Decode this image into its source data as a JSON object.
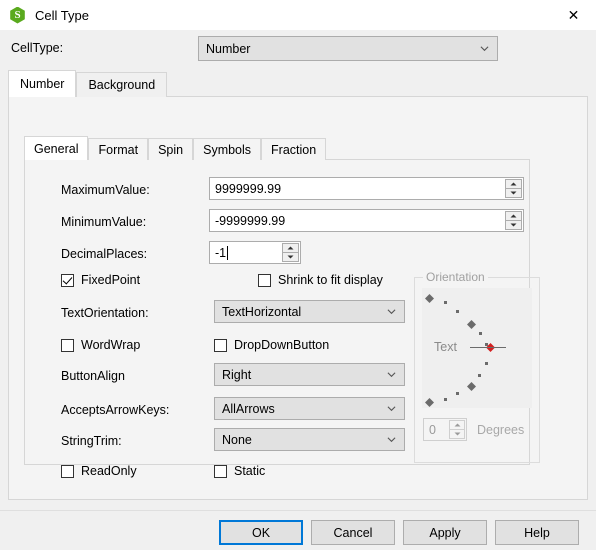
{
  "window": {
    "title": "Cell Type",
    "icon": "spreadsheet-logo-icon",
    "close_label": "✕"
  },
  "celltype": {
    "label": "CellType:",
    "value": "Number"
  },
  "outer_tabs": [
    {
      "label": "Number",
      "active": true
    },
    {
      "label": "Background",
      "active": false
    }
  ],
  "inner_tabs": [
    {
      "label": "General",
      "active": true
    },
    {
      "label": "Format",
      "active": false
    },
    {
      "label": "Spin",
      "active": false
    },
    {
      "label": "Symbols",
      "active": false
    },
    {
      "label": "Fraction",
      "active": false
    }
  ],
  "general": {
    "maximum_value": {
      "label": "MaximumValue:",
      "value": "9999999.99"
    },
    "minimum_value": {
      "label": "MinimumValue:",
      "value": "-9999999.99"
    },
    "decimal_places": {
      "label": "DecimalPlaces:",
      "value": "-1"
    },
    "fixed_point": {
      "label": "FixedPoint",
      "checked": true
    },
    "shrink_to_fit": {
      "label": "Shrink to fit display",
      "checked": false
    },
    "text_orientation": {
      "label": "TextOrientation:",
      "value": "TextHorizontal"
    },
    "word_wrap": {
      "label": "WordWrap",
      "checked": false
    },
    "drop_down_button": {
      "label": "DropDownButton",
      "checked": false
    },
    "button_align": {
      "label": "ButtonAlign",
      "value": "Right"
    },
    "accepts_arrow_keys": {
      "label": "AcceptsArrowKeys:",
      "value": "AllArrows"
    },
    "string_trim": {
      "label": "StringTrim:",
      "value": "None"
    },
    "read_only": {
      "label": "ReadOnly",
      "checked": false
    },
    "static": {
      "label": "Static",
      "checked": false
    }
  },
  "orientation": {
    "legend": "Orientation",
    "dial_text": "Text",
    "degrees_value": "0",
    "degrees_label": "Degrees",
    "selected_color": "#d42020",
    "disabled": true
  },
  "buttons": {
    "ok": "OK",
    "cancel": "Cancel",
    "apply": "Apply",
    "help": "Help",
    "focus_color": "#0078d7"
  }
}
